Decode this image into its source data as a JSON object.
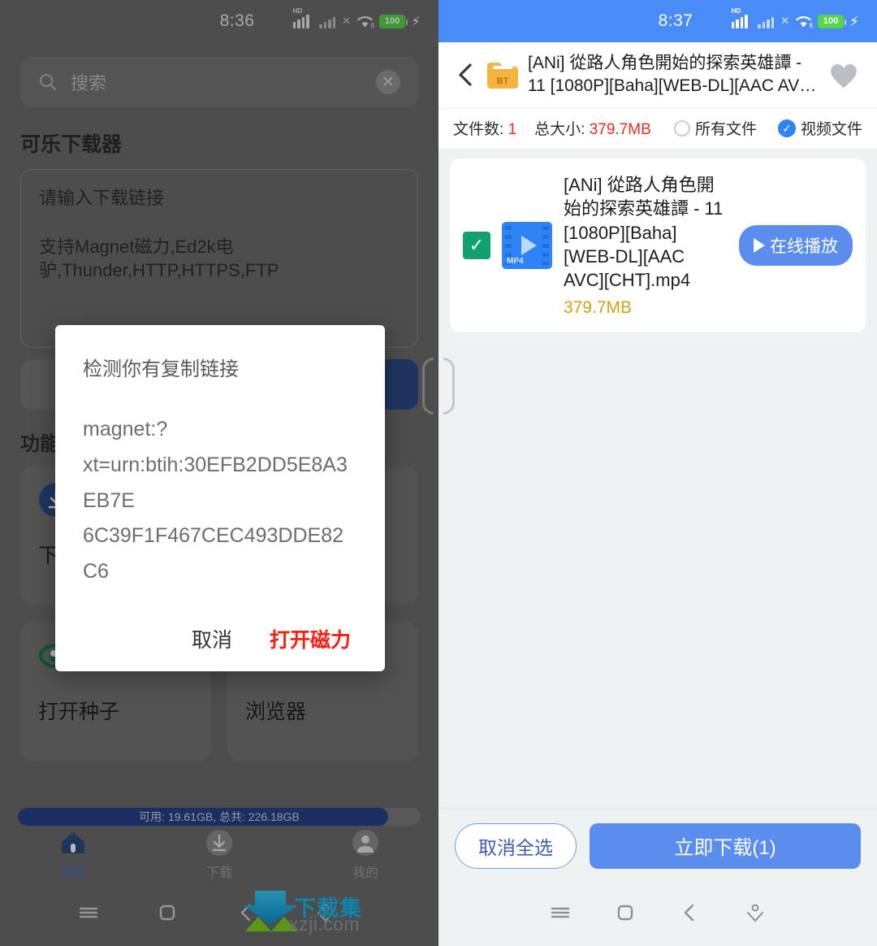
{
  "left": {
    "status": {
      "time": "8:36",
      "network": "HD",
      "battery_level": "100",
      "wifi_gen": "6"
    },
    "search": {
      "placeholder": "搜索",
      "icon": "search-icon",
      "clear_icon": "close-circle-icon"
    },
    "app_title": "可乐下载器",
    "link_input": {
      "hint": "请输入下载链接",
      "supported": "支持Magnet磁力,Ed2k电驴,Thunder,HTTP,HTTPS,FTP"
    },
    "section_label": "功能",
    "download_tile_label": "下载",
    "tiles": [
      {
        "label": "打开种子",
        "icon": "torrent-icon"
      },
      {
        "label": "浏览器",
        "icon": "globe-icon"
      }
    ],
    "storage": {
      "text": "可用: 19.61GB, 总共: 226.18GB",
      "available": "19.61GB",
      "total": "226.18GB"
    },
    "tabs": [
      {
        "label": "首页",
        "icon": "home-icon",
        "active": true
      },
      {
        "label": "下载",
        "icon": "download-circle-icon",
        "active": false
      },
      {
        "label": "我的",
        "icon": "person-circle-icon",
        "active": false
      }
    ],
    "dialog": {
      "title": "检测你有复制链接",
      "line1": "magnet:?",
      "line2": "xt=urn:btih:30EFB2DD5E8A3EB7E",
      "line3": "6C39F1F467CEC493DDE82C6",
      "cancel": "取消",
      "confirm": "打开磁力",
      "confirm_color": "#ff1d12"
    },
    "watermark": {
      "title": "下载集",
      "url": "xzji.com"
    }
  },
  "right": {
    "status": {
      "time": "8:37",
      "network": "HD",
      "battery_level": "100",
      "wifi_gen": "6",
      "bar_color": "#4a8cf7"
    },
    "header": {
      "back_icon": "chevron-left-icon",
      "folder_icon": "bt-folder-icon",
      "folder_badge": "BT",
      "title": "[ANi] 從路人角色開始的探索英雄譚 - 11 [1080P][Baha][WEB-DL][AAC AVC][...",
      "favorite_icon": "heart-icon"
    },
    "meta": {
      "count_label": "文件数:",
      "count_value": "1",
      "size_label": "总大小:",
      "size_value": "379.7MB",
      "filters": [
        {
          "label": "所有文件",
          "selected": false
        },
        {
          "label": "视频文件",
          "selected": true
        }
      ]
    },
    "files": [
      {
        "checked": true,
        "ext": "MP4",
        "name": "[ANi] 從路人角色開始的探索英雄譚 - 11 [1080P][Baha][WEB-DL][AAC AVC][CHT].mp4",
        "size": "379.7MB",
        "play_label": "在线播放"
      }
    ],
    "actions": {
      "deselect_all": "取消全选",
      "download_now": "立即下载(1)"
    }
  },
  "navbar": {
    "menu_icon": "menu-icon",
    "square_icon": "square-icon",
    "back_icon": "chevron-left-icon",
    "down_icon": "pointer-down-icon"
  }
}
